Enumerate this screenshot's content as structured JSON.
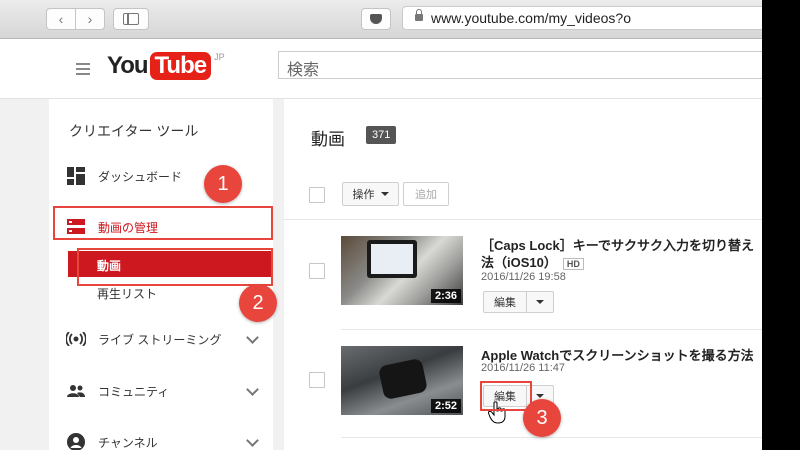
{
  "browser": {
    "url": "www.youtube.com/my_videos?o"
  },
  "masthead": {
    "logo_you": "You",
    "logo_tube": "Tube",
    "logo_region": "JP",
    "search_placeholder": "検索"
  },
  "sidebar": {
    "title": "クリエイター ツール",
    "items": [
      {
        "label": "ダッシュボード",
        "icon": "dashboard-icon"
      },
      {
        "label": "動画の管理",
        "icon": "video-manager-icon",
        "active": true
      },
      {
        "label": "ライブ ストリーミング",
        "icon": "live-streaming-icon"
      },
      {
        "label": "コミュニティ",
        "icon": "community-icon"
      },
      {
        "label": "チャンネル",
        "icon": "channel-icon"
      }
    ],
    "sub_items": [
      {
        "label": "動画",
        "active": true
      },
      {
        "label": "再生リスト"
      }
    ]
  },
  "main": {
    "title": "動画",
    "count": "371",
    "actions_label": "操作",
    "add_label": "追加",
    "videos": [
      {
        "title_line1": "［Caps Lock］キーでサクサク入力を切り替え",
        "title_line2": "法（iOS10）",
        "badge": "HD",
        "date": "2016/11/26 19:58",
        "duration": "2:36",
        "edit_label": "編集"
      },
      {
        "title_line1": "Apple Watchでスクリーンショットを撮る方法",
        "date": "2016/11/26 11:47",
        "duration": "2:52",
        "edit_label": "編集"
      }
    ]
  },
  "callouts": [
    "1",
    "2",
    "3"
  ],
  "colors": {
    "accent": "#cc181e",
    "callout": "#e8453c",
    "logo_red": "#e62117"
  }
}
